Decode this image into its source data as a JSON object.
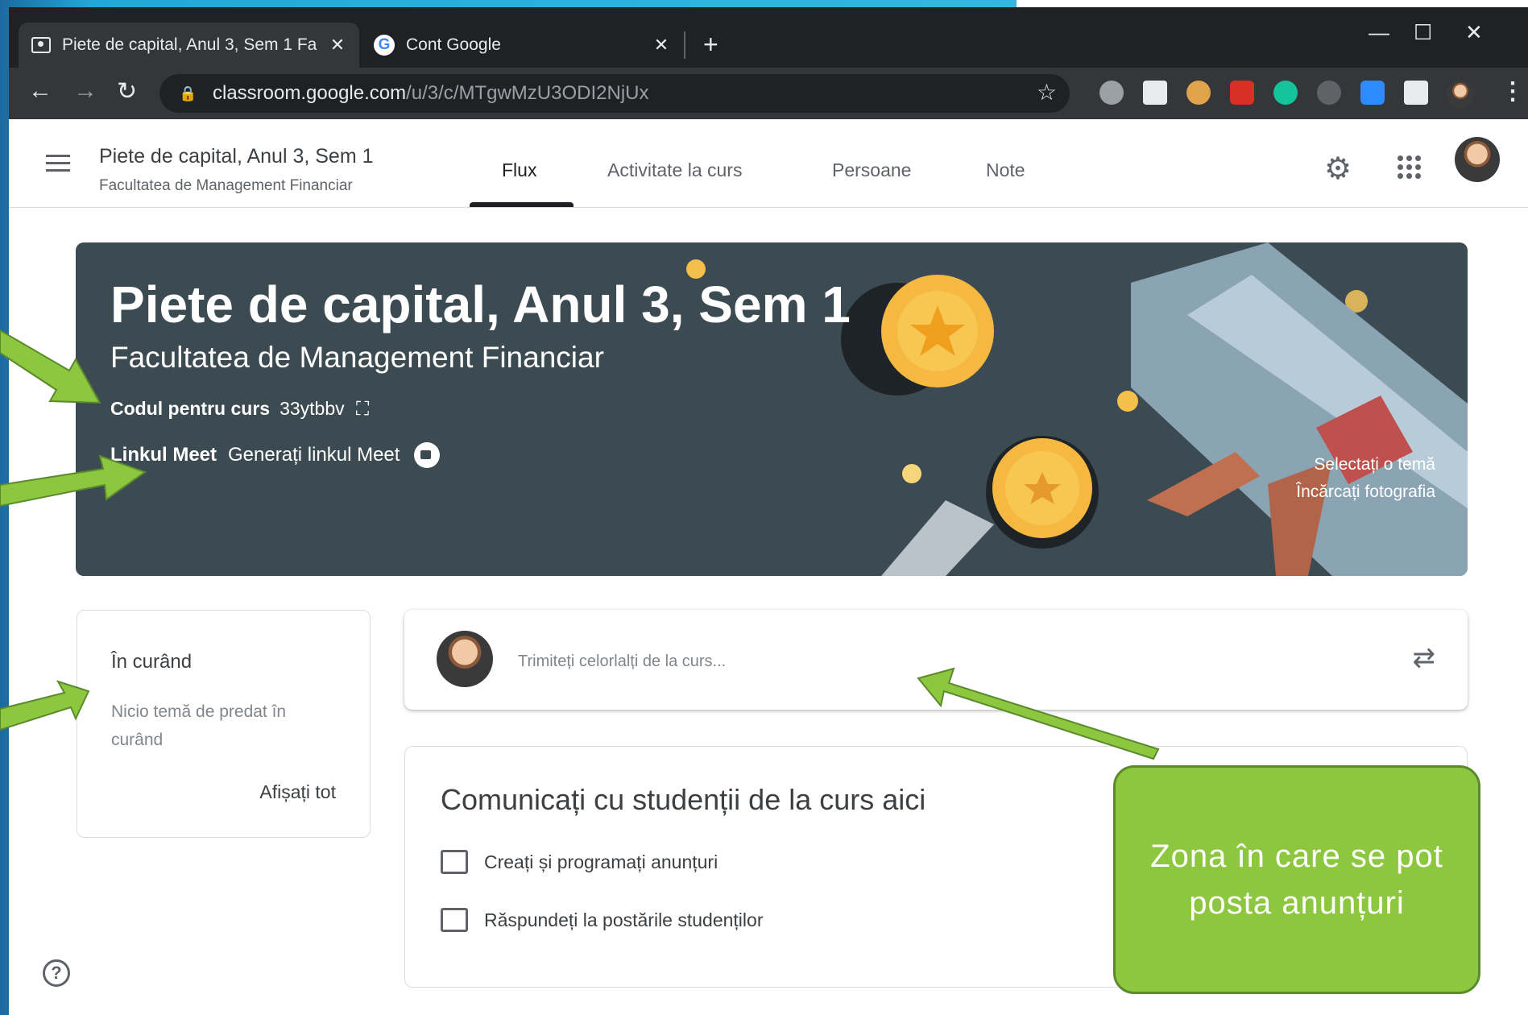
{
  "browser": {
    "tabs": [
      {
        "title": "Piete de capital, Anul 3, Sem 1 Fa"
      },
      {
        "title": "Cont Google"
      }
    ],
    "url_host": "classroom.google.com",
    "url_path": "/u/3/c/MTgwMzU3ODI2NjUx",
    "window_controls": {
      "minimize": "—",
      "maximize": "☐",
      "close": "✕"
    }
  },
  "header": {
    "title": "Piete de capital, Anul 3, Sem 1",
    "subtitle": "Facultatea de Management Financiar",
    "tabs": [
      "Flux",
      "Activitate la curs",
      "Persoane",
      "Note"
    ]
  },
  "banner": {
    "title": "Piete de capital, Anul 3, Sem 1",
    "subtitle": "Facultatea de Management Financiar",
    "code_label": "Codul pentru curs",
    "code_value": "33ytbbv",
    "meet_label": "Linkul Meet",
    "meet_action": "Generați linkul Meet",
    "select_theme": "Selectați o temă",
    "upload_photo": "Încărcați fotografia"
  },
  "upcoming": {
    "title": "În curând",
    "empty": "Nicio temă de predat în curând",
    "view_all": "Afișați tot"
  },
  "post": {
    "placeholder": "Trimiteți celorlalți de la curs..."
  },
  "communicate": {
    "title": "Comunicați cu studenții de la curs aici",
    "items": [
      "Creați și programați anunțuri",
      "Răspundeți la postările studenților"
    ]
  },
  "callout": {
    "text": "Zona în care se pot posta anunțuri"
  },
  "colors": {
    "banner_bg": "#3c4a52",
    "callout_bg": "#8dc63f",
    "arrow": "#8dc63f"
  }
}
